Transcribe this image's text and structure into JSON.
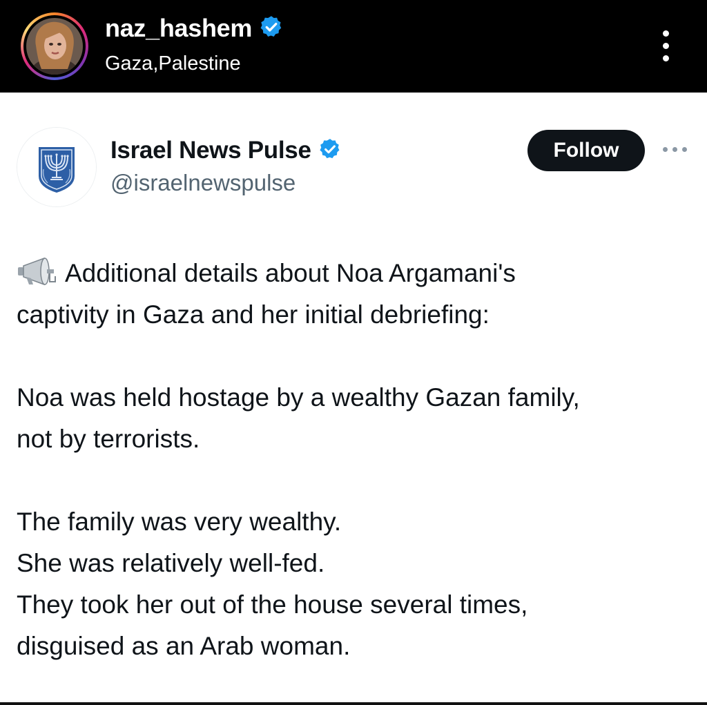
{
  "instagram_header": {
    "username": "naz_hashem",
    "location": "Gaza,Palestine",
    "verified_icon": "verified-badge-icon",
    "more_icon": "vertical-dots-icon"
  },
  "tweet": {
    "display_name": "Israel News Pulse",
    "handle": "@israelnewspulse",
    "follow_label": "Follow",
    "avatar_icon": "menorah-emblem-icon",
    "verified_icon": "verified-badge-icon",
    "more_icon": "horizontal-dots-icon",
    "lead_icon": "megaphone-icon",
    "lines": [
      "Additional details about Noa Argamani's",
      "captivity in Gaza and her initial debriefing:",
      "Noa was held hostage by a wealthy Gazan family,",
      "not by terrorists.",
      "The family was very wealthy.",
      "She was relatively well-fed.",
      "They took her out of the house several times,",
      "disguised as an Arab woman."
    ]
  },
  "colors": {
    "header_bg": "#000000",
    "verified_blue": "#1d9bf0",
    "text_primary": "#0f1419",
    "text_secondary": "#536471",
    "follow_bg": "#0f1419"
  }
}
